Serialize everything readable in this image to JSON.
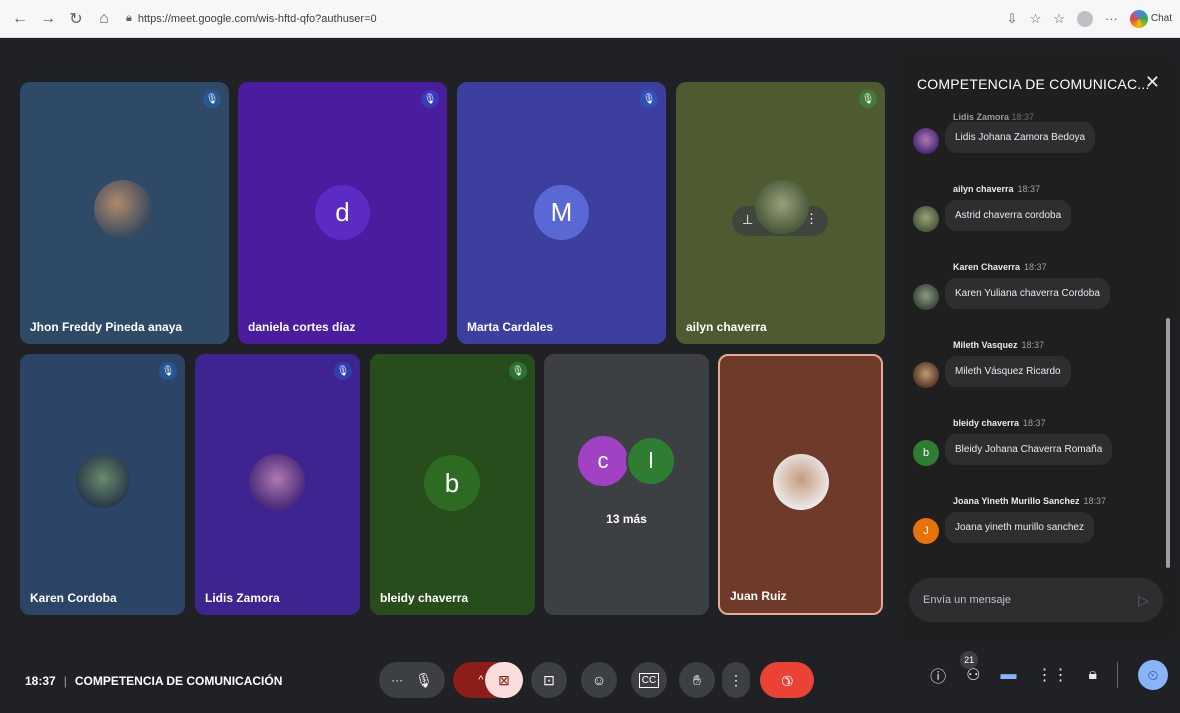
{
  "browser": {
    "url": "https://meet.google.com/wis-hftd-qfo?authuser=0",
    "chat_label": "Chat"
  },
  "tiles": [
    {
      "name": "Jhon Freddy Pineda anaya",
      "avatar_type": "photo",
      "bg": "#2e4a66",
      "mic": "muted"
    },
    {
      "name": "daniela cortes díaz",
      "avatar_letter": "d",
      "avatar_bg": "#5b2bc4",
      "bg": "#4a1c9e",
      "mic": "muted"
    },
    {
      "name": "Marta Cardales",
      "avatar_letter": "M",
      "avatar_bg": "#5a68d6",
      "bg": "#3c3f9e",
      "mic": "muted"
    },
    {
      "name": "ailyn chaverra",
      "avatar_type": "photo",
      "bg": "#4e5a30",
      "mic": "muted-green"
    },
    {
      "name": "Karen Cordoba",
      "avatar_type": "photo",
      "bg": "#2c4566",
      "mic": "muted"
    },
    {
      "name": "Lidis Zamora",
      "avatar_type": "photo",
      "bg": "#3e2490",
      "mic": "muted"
    },
    {
      "name": "bleidy chaverra",
      "avatar_letter": "b",
      "avatar_bg": "#2e6b22",
      "bg": "#284d1c",
      "mic": "muted-green"
    },
    {
      "name": "",
      "others_letters": [
        "c",
        "l"
      ],
      "others_label": "13 más",
      "bg": "#3c4043"
    },
    {
      "name": "Juan Ruiz",
      "avatar_type": "photo",
      "bg": "#6e3a2a"
    }
  ],
  "chat": {
    "title": "COMPETENCIA DE COMUNICAC...",
    "partial_top_sender": "Lidis Zamora",
    "partial_top_time": "18:37",
    "messages": [
      {
        "sender": "",
        "time": "",
        "text": "Lidis Johana Zamora Bedoya",
        "avatar_bg": "#5a3fa0"
      },
      {
        "sender": "ailyn chaverra",
        "time": "18:37",
        "text": "Astrid chaverra cordoba",
        "avatar_bg": "#4e7a3a"
      },
      {
        "sender": "Karen Chaverra",
        "time": "18:37",
        "text": "Karen Yuliana chaverra Cordoba",
        "avatar_bg": "#5a6a50"
      },
      {
        "sender": "Mileth Vasquez",
        "time": "18:37",
        "text": "Mileth Vásquez Ricardo",
        "avatar_bg": "#7a5a3a"
      },
      {
        "sender": "bleidy chaverra",
        "time": "18:37",
        "text": "Bleidy Johana Chaverra Romaña",
        "avatar_letter": "b",
        "avatar_bg": "#2e7d32"
      },
      {
        "sender": "Joana Yineth Murillo Sanchez",
        "time": "18:37",
        "text": "Joana yineth murillo sanchez",
        "avatar_letter": "J",
        "avatar_bg": "#e8710a"
      }
    ],
    "input_placeholder": "Envía un mensaje"
  },
  "meeting": {
    "time": "18:37",
    "title": "COMPETENCIA DE COMUNICACIÓN",
    "participant_count": "21"
  }
}
